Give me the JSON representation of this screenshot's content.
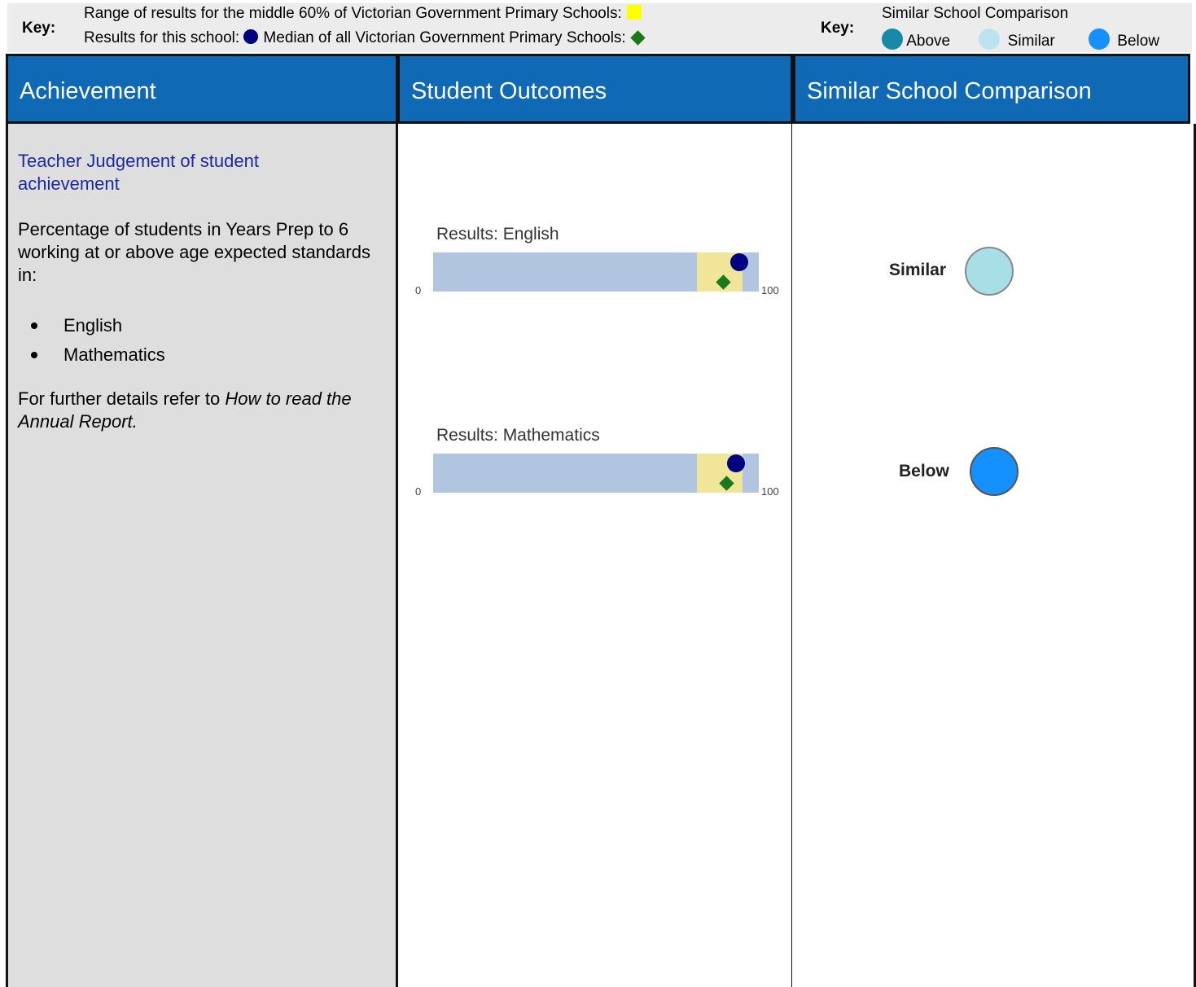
{
  "key_bar": {
    "left_key_label": "Key:",
    "left_line1": "Range of results for the middle 60% of Victorian Government Primary Schools:",
    "left_line2a": "Results for this school:",
    "left_line2b": "Median of all Victorian Government Primary Schools:",
    "right_key_label": "Key:",
    "right_title": "Similar School Comparison",
    "legend": [
      {
        "label": "Above",
        "color": "#1889a8"
      },
      {
        "label": "Similar",
        "color": "#bee3f0"
      },
      {
        "label": "Below",
        "color": "#1590ff"
      }
    ]
  },
  "columns": {
    "achievement": "Achievement",
    "student_outcomes": "Student Outcomes",
    "similar_school_comparison": "Similar School Comparison"
  },
  "achievement": {
    "title": "Teacher Judgement of student achievement",
    "description": "Percentage of students in Years Prep to 6 working at or above age expected standards in:",
    "items": [
      "English",
      "Mathematics"
    ],
    "more_prefix": "For further details refer to ",
    "more_italic": "How to read the Annual Report."
  },
  "chart_data": [
    {
      "type": "bar",
      "title": "Results: English",
      "xlim": [
        0,
        100
      ],
      "tick_labels": [
        "0",
        "100"
      ],
      "middle_60_range": [
        81,
        95
      ],
      "school_result": 94,
      "state_median": 89
    },
    {
      "type": "bar",
      "title": "Results: Mathematics",
      "xlim": [
        0,
        100
      ],
      "tick_labels": [
        "0",
        "100"
      ],
      "middle_60_range": [
        81,
        95
      ],
      "school_result": 93,
      "state_median": 90
    }
  ],
  "comparison": [
    {
      "label": "Similar",
      "color": "#a8dfe6"
    },
    {
      "label": "Below",
      "color": "#1590ff"
    }
  ],
  "colors": {
    "header_blue": "#0f69b4",
    "range_yellow": "#ffff00",
    "result_navy": "#000080",
    "median_green": "#1a7a1a"
  }
}
